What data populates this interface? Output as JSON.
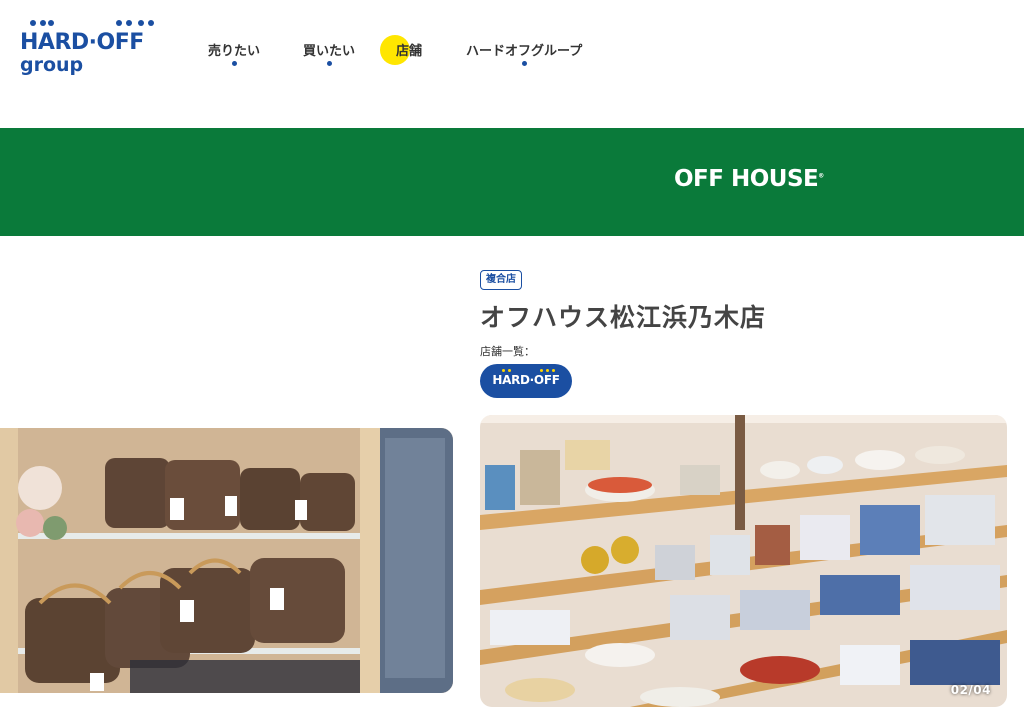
{
  "header": {
    "logo": {
      "main": "HARD·OFF",
      "sub": "group",
      "registered": "®"
    },
    "nav": [
      {
        "label": "売りたい",
        "has_dot": true
      },
      {
        "label": "買いたい",
        "has_dot": true
      },
      {
        "label": "店舗",
        "has_dot": false,
        "highlighted": true
      },
      {
        "label": "ハードオフグループ",
        "has_dot": true
      }
    ]
  },
  "banner": {
    "brand_logo": "OFF HOUSE",
    "registered": "®",
    "background": "#0a7a3a"
  },
  "store": {
    "tag": "複合店",
    "title": "オフハウス松江浜乃木店",
    "list_label": "店舗一覧：",
    "brands": [
      {
        "label": "HARD·OFF"
      }
    ]
  },
  "gallery": {
    "counter": "02/04",
    "images": [
      {
        "name": "brand-bags-showcase",
        "icon": "photo-icon"
      },
      {
        "name": "tableware-shelves",
        "icon": "photo-icon"
      }
    ]
  },
  "colors": {
    "brand_blue": "#1b4fa2",
    "highlight_yellow": "#ffe600",
    "banner_green": "#0a7a3a"
  }
}
